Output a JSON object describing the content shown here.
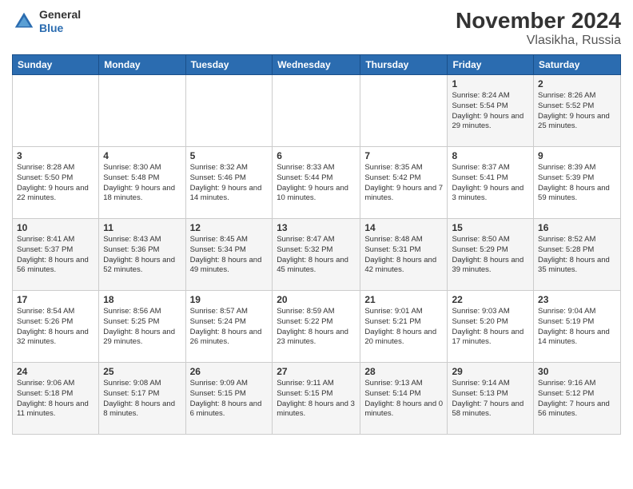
{
  "header": {
    "logo_general": "General",
    "logo_blue": "Blue",
    "title": "November 2024",
    "subtitle": "Vlasikha, Russia"
  },
  "columns": [
    "Sunday",
    "Monday",
    "Tuesday",
    "Wednesday",
    "Thursday",
    "Friday",
    "Saturday"
  ],
  "weeks": [
    [
      {
        "day": "",
        "info": ""
      },
      {
        "day": "",
        "info": ""
      },
      {
        "day": "",
        "info": ""
      },
      {
        "day": "",
        "info": ""
      },
      {
        "day": "",
        "info": ""
      },
      {
        "day": "1",
        "info": "Sunrise: 8:24 AM\nSunset: 5:54 PM\nDaylight: 9 hours and 29 minutes."
      },
      {
        "day": "2",
        "info": "Sunrise: 8:26 AM\nSunset: 5:52 PM\nDaylight: 9 hours and 25 minutes."
      }
    ],
    [
      {
        "day": "3",
        "info": "Sunrise: 8:28 AM\nSunset: 5:50 PM\nDaylight: 9 hours and 22 minutes."
      },
      {
        "day": "4",
        "info": "Sunrise: 8:30 AM\nSunset: 5:48 PM\nDaylight: 9 hours and 18 minutes."
      },
      {
        "day": "5",
        "info": "Sunrise: 8:32 AM\nSunset: 5:46 PM\nDaylight: 9 hours and 14 minutes."
      },
      {
        "day": "6",
        "info": "Sunrise: 8:33 AM\nSunset: 5:44 PM\nDaylight: 9 hours and 10 minutes."
      },
      {
        "day": "7",
        "info": "Sunrise: 8:35 AM\nSunset: 5:42 PM\nDaylight: 9 hours and 7 minutes."
      },
      {
        "day": "8",
        "info": "Sunrise: 8:37 AM\nSunset: 5:41 PM\nDaylight: 9 hours and 3 minutes."
      },
      {
        "day": "9",
        "info": "Sunrise: 8:39 AM\nSunset: 5:39 PM\nDaylight: 8 hours and 59 minutes."
      }
    ],
    [
      {
        "day": "10",
        "info": "Sunrise: 8:41 AM\nSunset: 5:37 PM\nDaylight: 8 hours and 56 minutes."
      },
      {
        "day": "11",
        "info": "Sunrise: 8:43 AM\nSunset: 5:36 PM\nDaylight: 8 hours and 52 minutes."
      },
      {
        "day": "12",
        "info": "Sunrise: 8:45 AM\nSunset: 5:34 PM\nDaylight: 8 hours and 49 minutes."
      },
      {
        "day": "13",
        "info": "Sunrise: 8:47 AM\nSunset: 5:32 PM\nDaylight: 8 hours and 45 minutes."
      },
      {
        "day": "14",
        "info": "Sunrise: 8:48 AM\nSunset: 5:31 PM\nDaylight: 8 hours and 42 minutes."
      },
      {
        "day": "15",
        "info": "Sunrise: 8:50 AM\nSunset: 5:29 PM\nDaylight: 8 hours and 39 minutes."
      },
      {
        "day": "16",
        "info": "Sunrise: 8:52 AM\nSunset: 5:28 PM\nDaylight: 8 hours and 35 minutes."
      }
    ],
    [
      {
        "day": "17",
        "info": "Sunrise: 8:54 AM\nSunset: 5:26 PM\nDaylight: 8 hours and 32 minutes."
      },
      {
        "day": "18",
        "info": "Sunrise: 8:56 AM\nSunset: 5:25 PM\nDaylight: 8 hours and 29 minutes."
      },
      {
        "day": "19",
        "info": "Sunrise: 8:57 AM\nSunset: 5:24 PM\nDaylight: 8 hours and 26 minutes."
      },
      {
        "day": "20",
        "info": "Sunrise: 8:59 AM\nSunset: 5:22 PM\nDaylight: 8 hours and 23 minutes."
      },
      {
        "day": "21",
        "info": "Sunrise: 9:01 AM\nSunset: 5:21 PM\nDaylight: 8 hours and 20 minutes."
      },
      {
        "day": "22",
        "info": "Sunrise: 9:03 AM\nSunset: 5:20 PM\nDaylight: 8 hours and 17 minutes."
      },
      {
        "day": "23",
        "info": "Sunrise: 9:04 AM\nSunset: 5:19 PM\nDaylight: 8 hours and 14 minutes."
      }
    ],
    [
      {
        "day": "24",
        "info": "Sunrise: 9:06 AM\nSunset: 5:18 PM\nDaylight: 8 hours and 11 minutes."
      },
      {
        "day": "25",
        "info": "Sunrise: 9:08 AM\nSunset: 5:17 PM\nDaylight: 8 hours and 8 minutes."
      },
      {
        "day": "26",
        "info": "Sunrise: 9:09 AM\nSunset: 5:15 PM\nDaylight: 8 hours and 6 minutes."
      },
      {
        "day": "27",
        "info": "Sunrise: 9:11 AM\nSunset: 5:15 PM\nDaylight: 8 hours and 3 minutes."
      },
      {
        "day": "28",
        "info": "Sunrise: 9:13 AM\nSunset: 5:14 PM\nDaylight: 8 hours and 0 minutes."
      },
      {
        "day": "29",
        "info": "Sunrise: 9:14 AM\nSunset: 5:13 PM\nDaylight: 7 hours and 58 minutes."
      },
      {
        "day": "30",
        "info": "Sunrise: 9:16 AM\nSunset: 5:12 PM\nDaylight: 7 hours and 56 minutes."
      }
    ]
  ]
}
